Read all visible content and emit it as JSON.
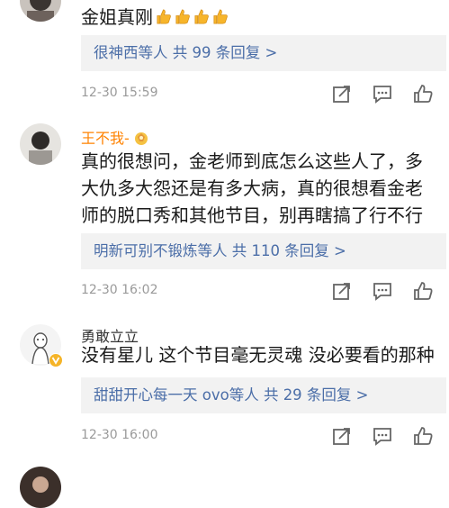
{
  "comments": [
    {
      "username": "",
      "text": "金姐真刚",
      "replies": "很神西等人  共 99 条回复 >",
      "time": "12-30 15:59"
    },
    {
      "username": "王不我-",
      "text": "真的很想问，金老师到底怎么这些人了，多大仇多大怨还是有多大病，真的很想看金老师的脱口秀和其他节目，别再瞎搞了行不行",
      "replies": "明新可别不锻炼等人  共 110 条回复 >",
      "time": "12-30 16:02"
    },
    {
      "username": "勇敢立立",
      "text": "没有星儿 这个节目毫无灵魂 没必要看的那种",
      "replies": "甜甜开心每一天 ovo等人  共 29 条回复 >",
      "time": "12-30 16:00"
    },
    {
      "username": "",
      "text": "",
      "replies": "",
      "time": ""
    }
  ],
  "colors": {
    "username_accent": "#ff8200",
    "reply_link": "#4b6ea8",
    "reply_bg": "#f2f2f2",
    "meta_gray": "#9a9a9a"
  },
  "icons": [
    "thumbs-up-emoji",
    "verified-badge",
    "speechless-emoji",
    "share-icon",
    "comment-icon",
    "like-icon"
  ]
}
